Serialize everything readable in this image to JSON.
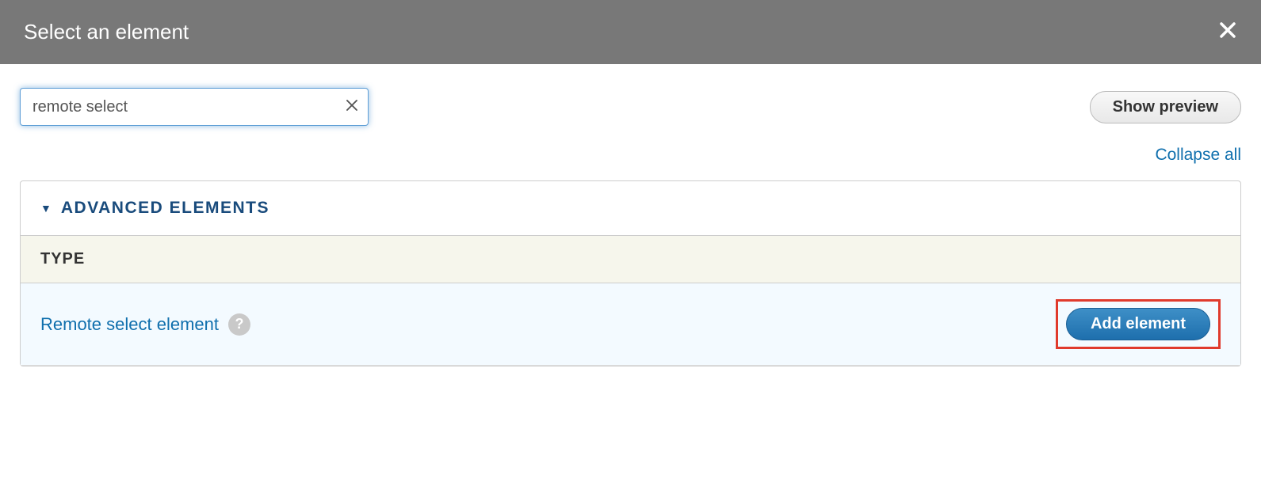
{
  "header": {
    "title": "Select an element"
  },
  "search": {
    "value": "remote select"
  },
  "buttons": {
    "show_preview": "Show preview",
    "collapse_all": "Collapse all",
    "add_element": "Add element"
  },
  "section": {
    "title": "ADVANCED ELEMENTS",
    "column_header": "TYPE"
  },
  "element": {
    "name": "Remote select element"
  }
}
